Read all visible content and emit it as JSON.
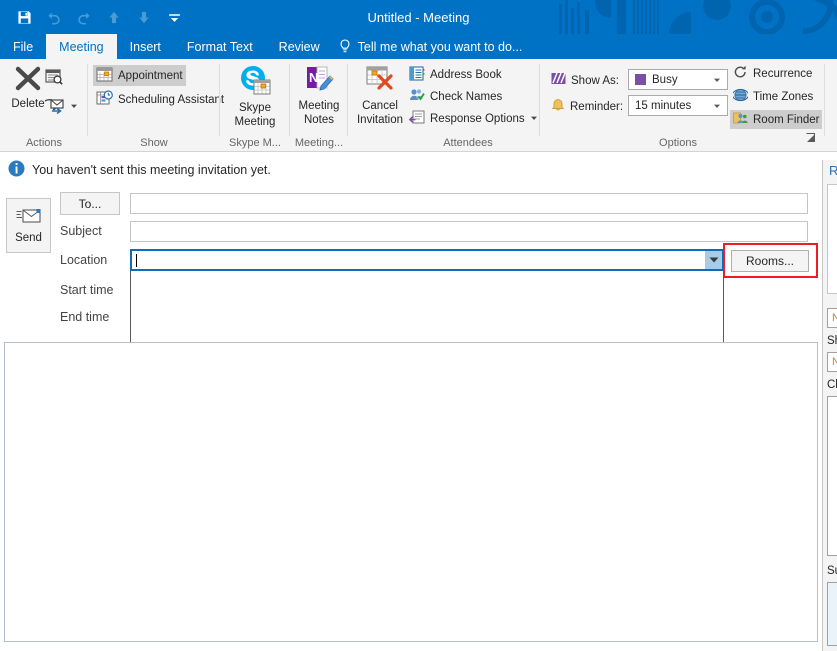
{
  "window": {
    "title": "Untitled - Meeting",
    "accent_color": "#0072c6"
  },
  "quick_access": [
    {
      "name": "save-icon",
      "label": "Save"
    },
    {
      "name": "undo-icon",
      "label": "Undo"
    },
    {
      "name": "redo-icon",
      "label": "Redo"
    },
    {
      "name": "previous-item-icon",
      "label": "Previous Item"
    },
    {
      "name": "next-item-icon",
      "label": "Next Item"
    },
    {
      "name": "customize-quick-access-toolbar-icon",
      "label": "Customize Quick Access Toolbar"
    }
  ],
  "tabs": [
    {
      "label": "File",
      "active": false
    },
    {
      "label": "Meeting",
      "active": true
    },
    {
      "label": "Insert",
      "active": false
    },
    {
      "label": "Format Text",
      "active": false
    },
    {
      "label": "Review",
      "active": false
    }
  ],
  "tell_me": {
    "label": "Tell me what you want to do..."
  },
  "ribbon": {
    "groups": [
      {
        "label": "Actions"
      },
      {
        "label": "Show"
      },
      {
        "label": "Skype M..."
      },
      {
        "label": "Meeting..."
      },
      {
        "label": "Attendees"
      },
      {
        "label": "Options"
      }
    ],
    "actions": {
      "delete_label": "Delete",
      "forward_label": "Forward",
      "calendar_label": "Calendar"
    },
    "show": {
      "appointment_label": "Appointment",
      "scheduling_assistant_label": "Scheduling Assistant"
    },
    "skype": {
      "label": "Skype\nMeeting",
      "line1": "Skype",
      "line2": "Meeting"
    },
    "meeting_notes": {
      "line1": "Meeting",
      "line2": "Notes"
    },
    "cancel_invitation": {
      "line1": "Cancel",
      "line2": "Invitation"
    },
    "attendees": {
      "address_book_label": "Address Book",
      "check_names_label": "Check Names",
      "response_options_label": "Response Options"
    },
    "options": {
      "show_as_label": "Show As:",
      "show_as_value": "Busy",
      "show_as_color": "#7b4ea8",
      "reminder_label": "Reminder:",
      "reminder_value": "15 minutes",
      "recurrence_label": "Recurrence",
      "time_zones_label": "Time Zones",
      "room_finder_label": "Room Finder"
    }
  },
  "infobar": {
    "message": "You haven't sent this meeting invitation yet."
  },
  "form": {
    "send_label": "Send",
    "to_label": "To...",
    "to_value": "",
    "subject_label": "Subject",
    "subject_value": "",
    "location_label": "Location",
    "location_value": "",
    "start_time_label": "Start time",
    "end_time_label": "End time",
    "rooms_label": "Rooms...",
    "rooms_highlight_color": "#ee1c25"
  },
  "body": {
    "text": ""
  },
  "room_finder": {
    "title": "Room Finder",
    "show_a_room_list_label": "Show a room list:",
    "room_list_value": "None",
    "choose_an_available_room_label": "Choose an available room:",
    "available_room_value": "None",
    "suggested_times_label": "Suggested times:"
  }
}
